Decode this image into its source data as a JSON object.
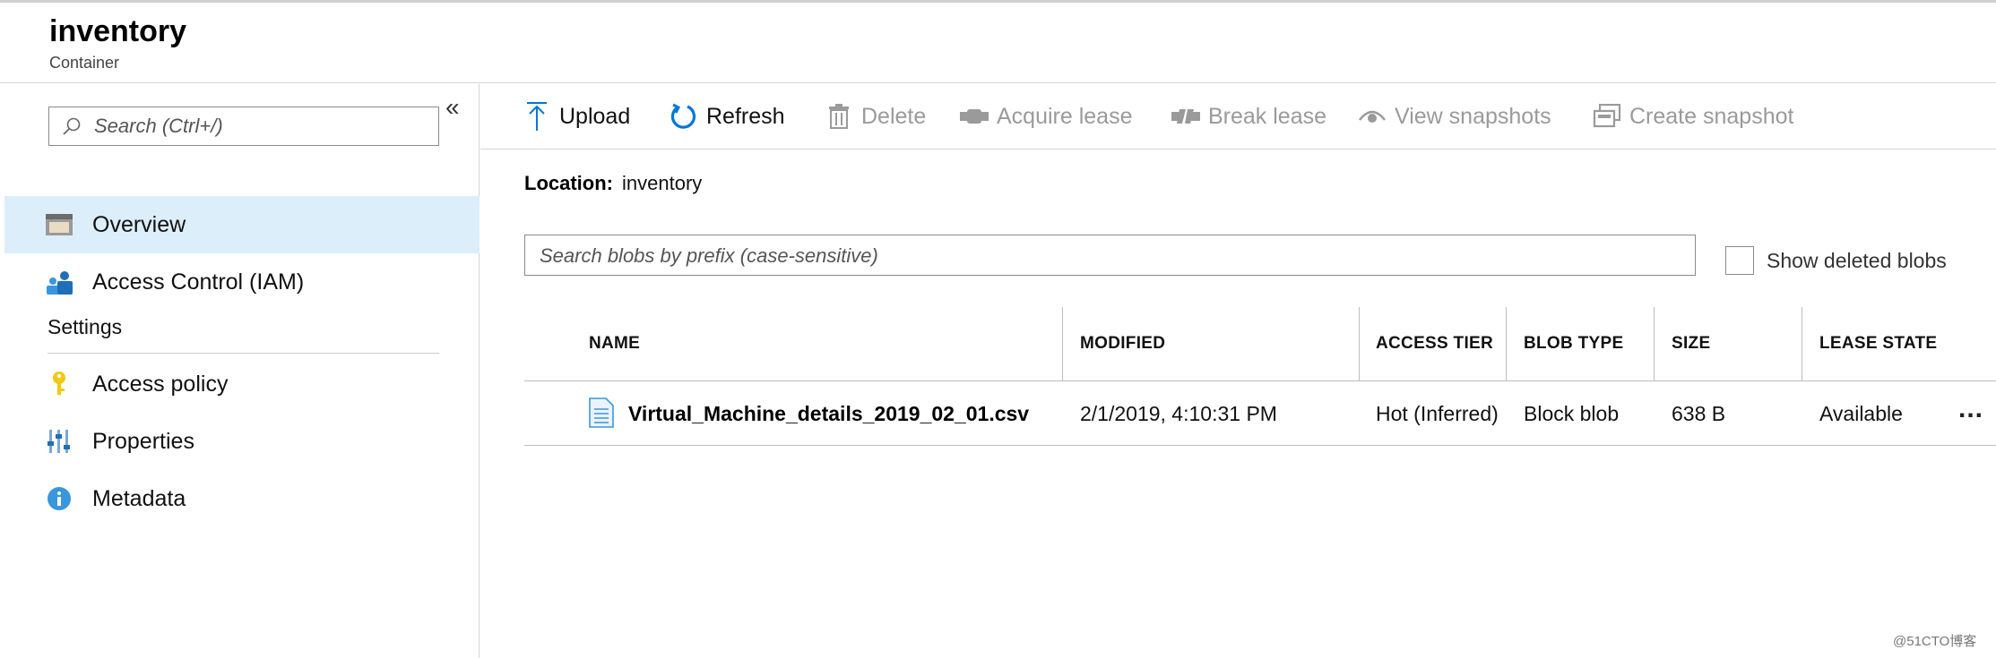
{
  "header": {
    "title": "inventory",
    "subtitle": "Container"
  },
  "sidebar": {
    "search_placeholder": "Search (Ctrl+/)",
    "collapse_glyph": "«",
    "items": [
      {
        "label": "Overview",
        "icon": "overview-icon",
        "active": true
      },
      {
        "label": "Access Control (IAM)",
        "icon": "iam-icon",
        "active": false
      }
    ],
    "settings_title": "Settings",
    "settings_items": [
      {
        "label": "Access policy",
        "icon": "key-icon"
      },
      {
        "label": "Properties",
        "icon": "properties-icon"
      },
      {
        "label": "Metadata",
        "icon": "info-icon"
      }
    ]
  },
  "toolbar": {
    "upload": "Upload",
    "refresh": "Refresh",
    "delete": "Delete",
    "acquire_lease": "Acquire lease",
    "break_lease": "Break lease",
    "view_snapshots": "View snapshots",
    "create_snapshot": "Create snapshot"
  },
  "location": {
    "label": "Location:",
    "value": "inventory"
  },
  "blob_search": {
    "placeholder": "Search blobs by prefix (case-sensitive)"
  },
  "show_deleted": {
    "label": "Show deleted blobs",
    "checked": false
  },
  "table": {
    "columns": [
      "NAME",
      "MODIFIED",
      "ACCESS TIER",
      "BLOB TYPE",
      "SIZE",
      "LEASE STATE"
    ],
    "rows": [
      {
        "name": "Virtual_Machine_details_2019_02_01.csv",
        "modified": "2/1/2019, 4:10:31 PM",
        "access_tier": "Hot (Inferred)",
        "blob_type": "Block blob",
        "size": "638 B",
        "lease_state": "Available",
        "more": "..."
      }
    ]
  },
  "watermark": "@51CTO博客",
  "colors": {
    "accent": "#0078d4",
    "active_nav_bg": "#ddeefb",
    "disabled_text": "#9a9a9a"
  }
}
